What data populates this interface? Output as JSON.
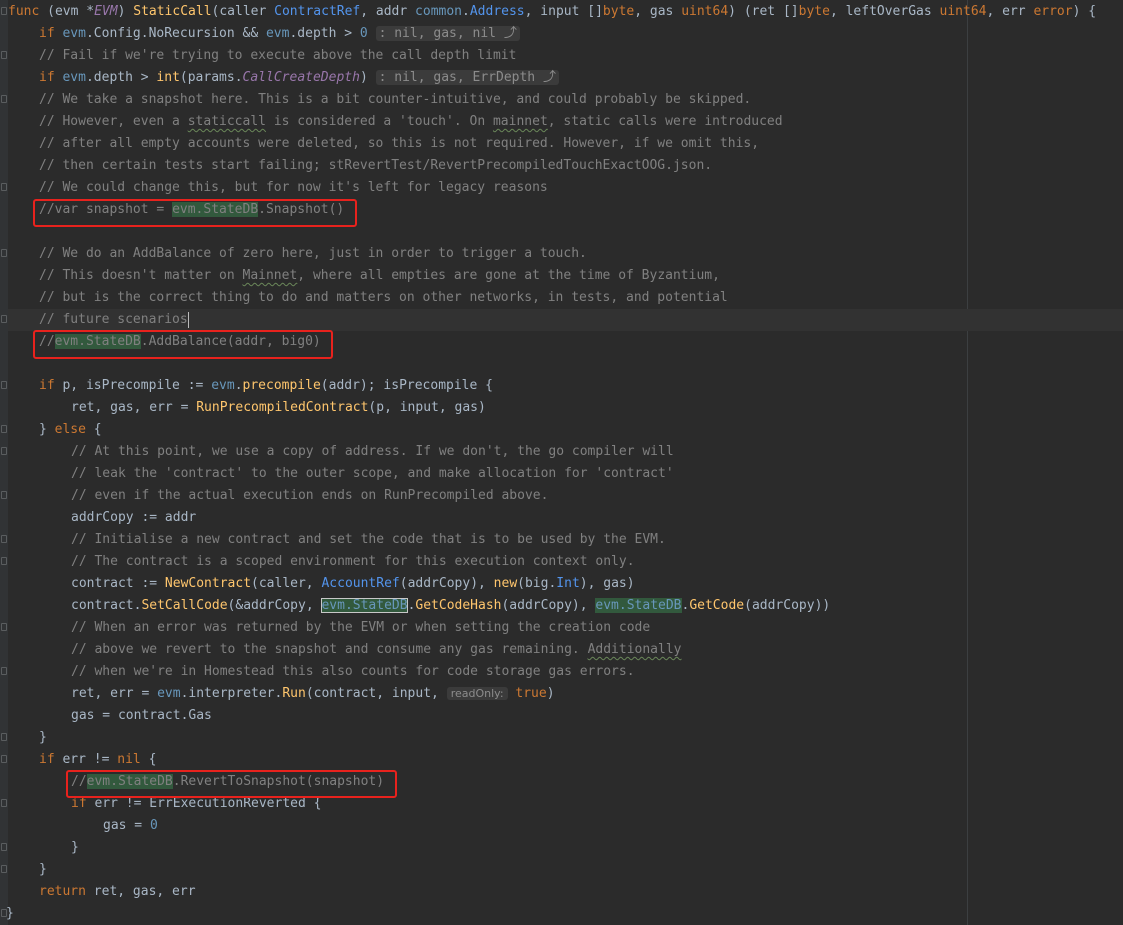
{
  "editor": {
    "language": "Go",
    "lines": {
      "l0": {
        "kw_func": "func",
        "open": " (",
        "recv": "evm",
        "star": " *",
        "recv_type": "EVM",
        "close": ") ",
        "name": "StaticCall",
        "p1": "(caller ",
        "t1": "ContractRef",
        "p2": ", addr ",
        "t2pkg": "common",
        "dot": ".",
        "t2": "Address",
        "p3": ", input []",
        "t3": "byte",
        "p4": ", gas ",
        "t4": "uint64",
        "p5": ") (ret []",
        "t5": "byte",
        "p6": ", leftOverGas ",
        "t6": "uint64",
        "p7": ", err ",
        "t7": "error",
        "p8": ") {"
      },
      "l1": {
        "kw_if": "if",
        "a": " ",
        "evm1": "evm",
        "b": ".Config.NoRecursion && ",
        "evm2": "evm",
        "c": ".depth > ",
        "num": "0",
        "d": " ",
        "hint": ": nil, gas, nil",
        "icon": "⤴"
      },
      "l2": {
        "comment": "// Fail if we're trying to execute above the call depth limit"
      },
      "l3": {
        "kw_if": "if",
        "a": " ",
        "evm": "evm",
        "b": ".depth > ",
        "int": "int",
        "c": "(params.",
        "const": "CallCreateDepth",
        "d": ") ",
        "hint": ": nil, gas, ErrDepth",
        "icon": "⤴"
      },
      "l4": {
        "comment": "// We take a snapshot here. This is a bit counter-intuitive, and could probably be skipped."
      },
      "l5": {
        "c1": "// However, even a ",
        "sq1": "staticcall",
        "c2": " is considered a 'touch'. On ",
        "sq2": "mainnet",
        "c3": ", static calls were introduced"
      },
      "l6": {
        "comment": "// after all empty accounts were deleted, so this is not required. However, if we omit this,"
      },
      "l7": {
        "comment": "// then certain tests start failing; stRevertTest/RevertPrecompiledTouchExactOOG.json."
      },
      "l8": {
        "comment": "// We could change this, but for now it's left for legacy reasons"
      },
      "l9": {
        "c1": "//var snapshot = ",
        "hl": "evm.StateDB",
        "c2": ".Snapshot()"
      },
      "l11": {
        "comment": "// We do an AddBalance of zero here, just in order to trigger a touch."
      },
      "l12": {
        "c1": "// This doesn't matter on ",
        "sq": "Mainnet",
        "c2": ", where all empties are gone at the time of Byzantium,"
      },
      "l13": {
        "comment": "// but is the correct thing to do and matters on other networks, in tests, and potential"
      },
      "l14": {
        "comment": "// future scenarios"
      },
      "l15": {
        "c1": "//",
        "hl": "evm.StateDB",
        "c2": ".AddBalance(addr, big0)"
      },
      "l17": {
        "kw_if": "if",
        "a": " p, isPrecompile := ",
        "evm": "evm",
        "b": ".",
        "fn": "precompile",
        "c": "(addr); isPrecompile {"
      },
      "l18": {
        "a": "ret, gas, err = ",
        "fn": "RunPrecompiledContract",
        "b": "(p, input, gas)"
      },
      "l19": {
        "a": "} ",
        "kw_else": "else",
        "b": " {"
      },
      "l20": {
        "comment": "// At this point, we use a copy of address. If we don't, the go compiler will"
      },
      "l21": {
        "comment": "// leak the 'contract' to the outer scope, and make allocation for 'contract'"
      },
      "l22": {
        "comment": "// even if the actual execution ends on RunPrecompiled above."
      },
      "l23": {
        "text": "addrCopy := addr"
      },
      "l24": {
        "comment": "// Initialise a new contract and set the code that is to be used by the EVM."
      },
      "l25": {
        "comment": "// The contract is a scoped environment for this execution context only."
      },
      "l26": {
        "a": "contract := ",
        "fn1": "NewContract",
        "b": "(caller, ",
        "fn2": "AccountRef",
        "c": "(addrCopy), ",
        "fn3": "new",
        "d": "(big.",
        "ty": "Int",
        "e": "), gas)"
      },
      "l27": {
        "a": "contract.",
        "fn1": "SetCallCode",
        "b": "(&addrCopy, ",
        "hl1": "evm.StateDB",
        "c": ".",
        "fn2": "GetCodeHash",
        "d": "(addrCopy), ",
        "hl2": "evm.StateDB",
        "e": ".",
        "fn3": "GetCode",
        "f": "(addrCopy))"
      },
      "l28": {
        "comment": "// When an error was returned by the EVM or when setting the creation code"
      },
      "l29": {
        "c1": "// above we revert to the snapshot and consume any gas remaining. ",
        "sq": "Additionally"
      },
      "l30": {
        "comment": "// when we're in Homestead this also counts for code storage gas errors."
      },
      "l31": {
        "a": "ret, err = ",
        "evm": "evm",
        "b": ".interpreter.",
        "fn": "Run",
        "c": "(contract, input, ",
        "hint": "readOnly:",
        "d": " ",
        "kw_true": "true",
        "e": ")"
      },
      "l32": {
        "text": "gas = contract.Gas"
      },
      "l33": {
        "text": "}"
      },
      "l34": {
        "kw_if": "if",
        "a": " err != ",
        "kw_nil": "nil",
        "b": " {"
      },
      "l35": {
        "c1": "//",
        "hl": "evm.StateDB",
        "c2": ".RevertToSnapshot(snapshot)"
      },
      "l36": {
        "kw_if": "if",
        "a": " err != ErrExecutionReverted {"
      },
      "l37": {
        "a": "gas = ",
        "num": "0"
      },
      "l38": {
        "text": "}"
      },
      "l39": {
        "text": "}"
      },
      "l40": {
        "kw_return": "return",
        "a": " ret, gas, err"
      },
      "l41": {
        "text": "}"
      }
    }
  },
  "colors": {
    "background": "#2b2b2b",
    "keyword": "#cc7832",
    "comment": "#808080",
    "function": "#ffc66d",
    "highlight": "#32593d",
    "annotation_box": "#e8221d"
  },
  "icons": {
    "inlay_return": "return-arrow-icon"
  }
}
